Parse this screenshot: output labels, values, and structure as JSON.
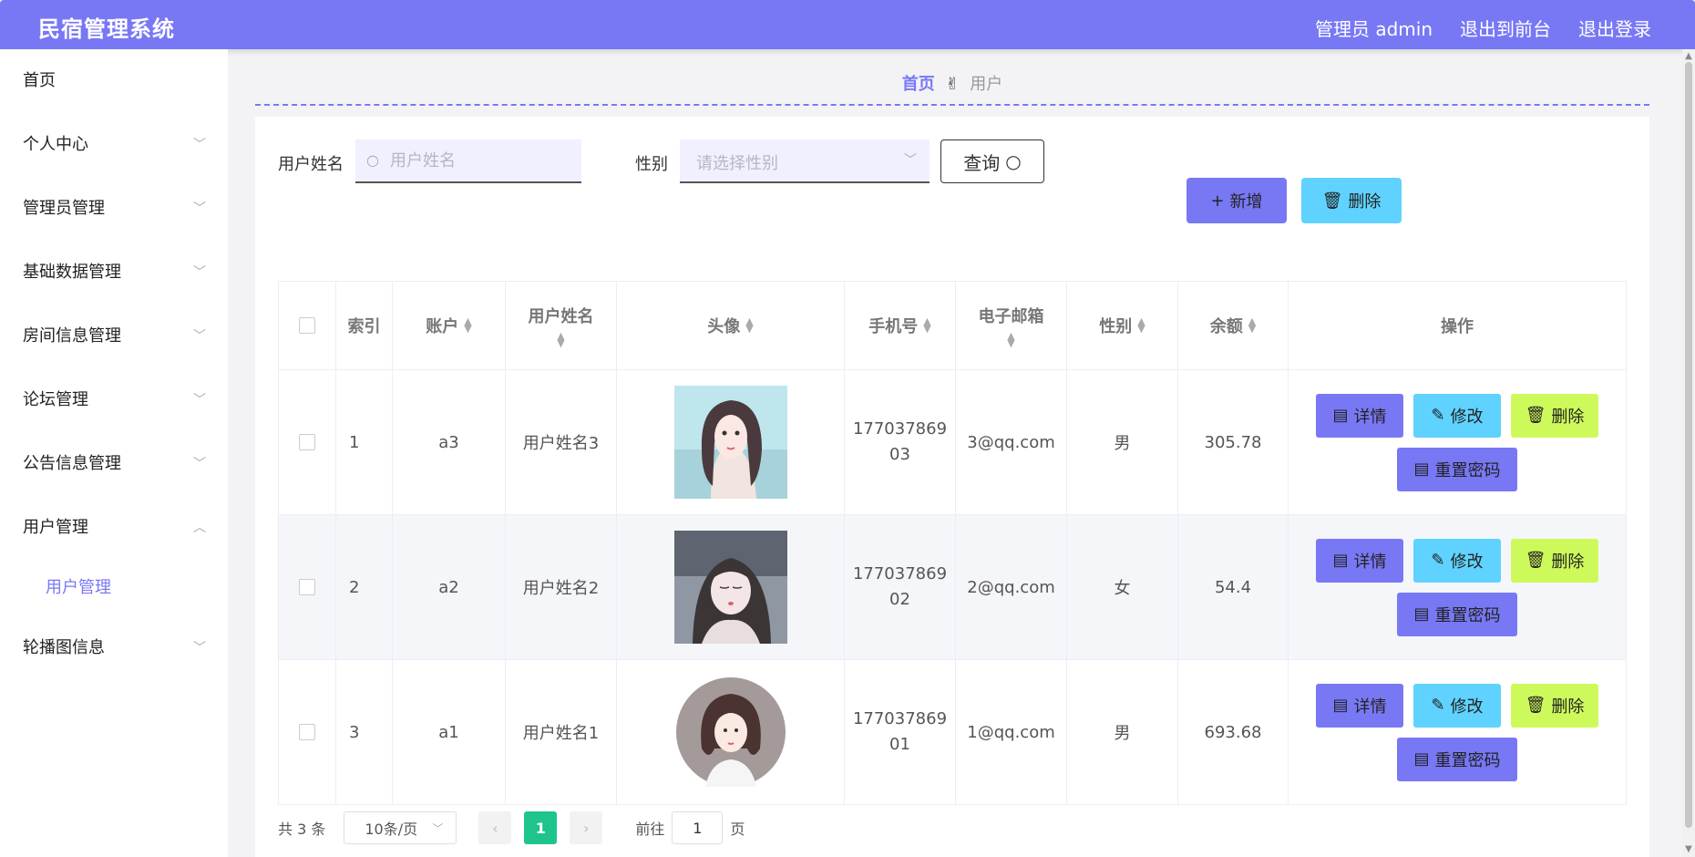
{
  "header": {
    "title": "民宿管理系统",
    "nav": [
      "管理员 admin",
      "退出到前台",
      "退出登录"
    ]
  },
  "sidebar": {
    "items": [
      {
        "label": "首页"
      },
      {
        "label": "个人中心"
      },
      {
        "label": "管理员管理"
      },
      {
        "label": "基础数据管理"
      },
      {
        "label": "房间信息管理"
      },
      {
        "label": "论坛管理"
      },
      {
        "label": "公告信息管理"
      },
      {
        "label": "用户管理"
      },
      {
        "label": "轮播图信息"
      }
    ],
    "sub_item": "用户管理"
  },
  "breadcrumb": {
    "home": "首页",
    "current": "用户"
  },
  "search": {
    "name_label": "用户姓名",
    "name_placeholder": "用户姓名",
    "gender_label": "性别",
    "gender_placeholder": "请选择性别",
    "query_label": "查询"
  },
  "actions": {
    "add_label": "新增",
    "delete_label": "删除"
  },
  "table": {
    "headers": {
      "index": "索引",
      "account": "账户",
      "name": "用户姓名",
      "avatar": "头像",
      "phone": "手机号",
      "email": "电子邮箱",
      "gender": "性别",
      "balance": "余额",
      "ops": "操作"
    },
    "rows": [
      {
        "index": "1",
        "account": "a3",
        "name": "用户姓名3",
        "phone_line1": "177037869",
        "phone_line2": "03",
        "email": "3@qq.com",
        "gender": "男",
        "balance": "305.78"
      },
      {
        "index": "2",
        "account": "a2",
        "name": "用户姓名2",
        "phone_line1": "177037869",
        "phone_line2": "02",
        "email": "2@qq.com",
        "gender": "女",
        "balance": "54.4"
      },
      {
        "index": "3",
        "account": "a1",
        "name": "用户姓名1",
        "phone_line1": "177037869",
        "phone_line2": "01",
        "email": "1@qq.com",
        "gender": "男",
        "balance": "693.68"
      }
    ],
    "ops": {
      "detail": "详情",
      "edit": "修改",
      "delete": "删除",
      "reset": "重置密码"
    }
  },
  "pagination": {
    "total": "共 3 条",
    "page_size": "10条/页",
    "current": "1",
    "goto_label": "前往",
    "goto_value": "1",
    "goto_suffix": "页"
  },
  "colors": {
    "primary": "#7878f5",
    "info": "#5fd2ff",
    "warn": "#cdfa5a",
    "success": "#1ec48c"
  }
}
